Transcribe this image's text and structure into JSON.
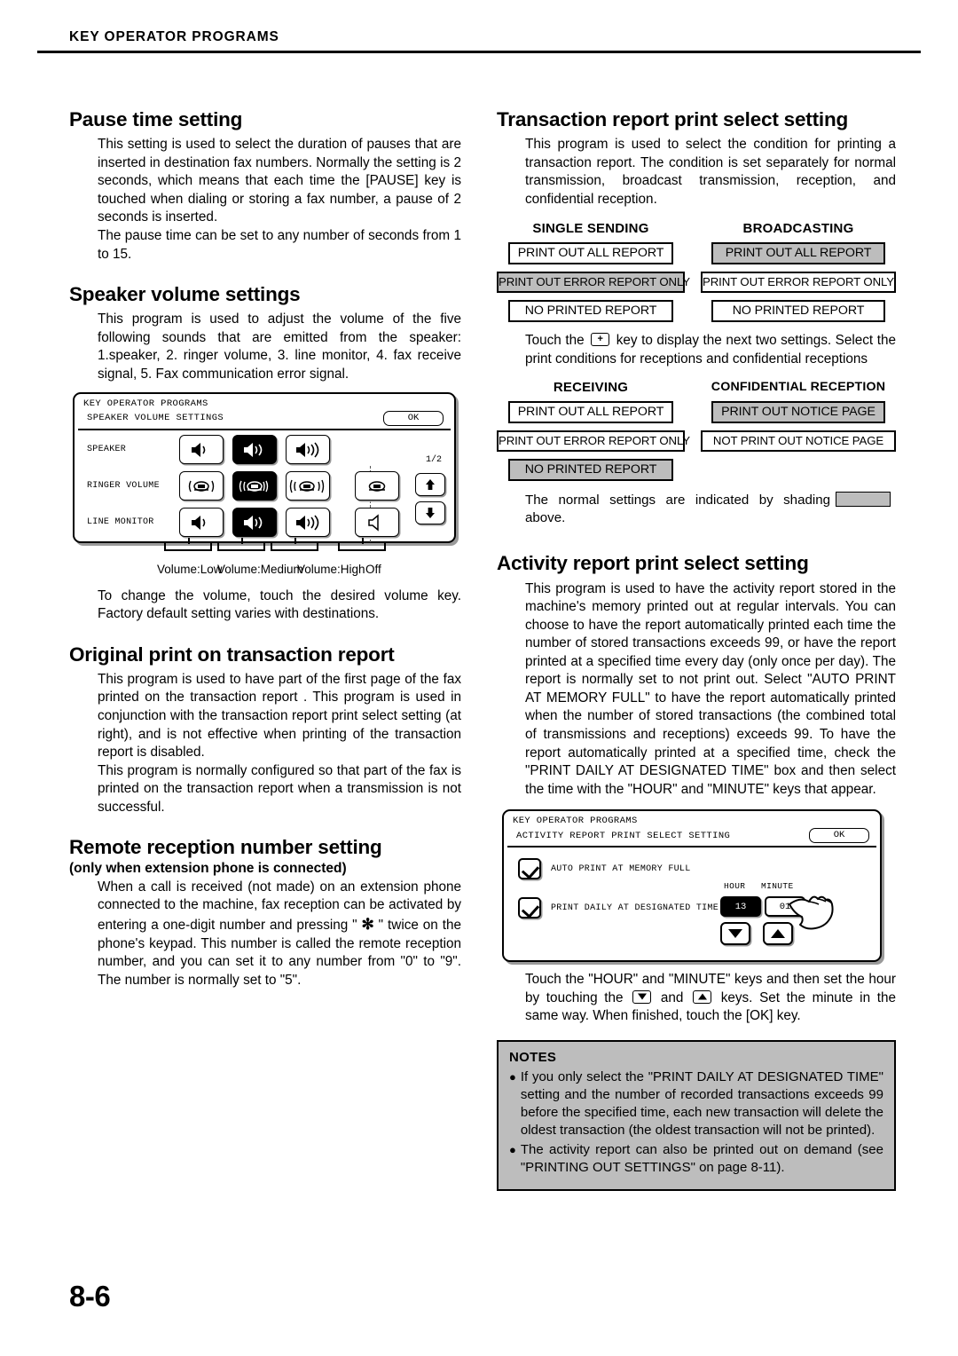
{
  "running_head": "KEY OPERATOR PROGRAMS",
  "folio": "8-6",
  "left_column": {
    "pause_time": {
      "heading": "Pause time setting",
      "p1": "This setting is used to select the duration of pauses that are inserted in destination fax numbers. Normally the setting is 2 seconds, which means that each time the [PAUSE] key is touched when dialing or storing a fax number, a pause of 2 seconds is inserted.",
      "p2": "The pause time can be set to any number of seconds from 1 to 15."
    },
    "speaker_volume": {
      "heading": "Speaker volume settings",
      "p1": "This program is used to adjust the volume of the five following sounds that are emitted from the speaker: 1.speaker, 2. ringer volume, 3. line monitor, 4. fax receive signal, 5. Fax communication error signal.",
      "panel": {
        "title": "KEY OPERATOR PROGRAMS",
        "subtitle": "SPEAKER VOLUME SETTINGS",
        "ok_label": "OK",
        "page_indicator": "1/2",
        "rows": [
          {
            "label": "SPEAKER",
            "keys": [
              "speaker-low",
              "speaker-medium",
              "speaker-high"
            ],
            "selected": 1,
            "has_off": false
          },
          {
            "label": "RINGER VOLUME",
            "keys": [
              "ringer-low",
              "ringer-medium",
              "ringer-high",
              "ringer-off"
            ],
            "selected": 1,
            "has_off": true
          },
          {
            "label": "LINE MONITOR",
            "keys": [
              "monitor-low",
              "monitor-medium",
              "monitor-high",
              "monitor-off"
            ],
            "selected": 1,
            "has_off": true
          }
        ],
        "column_labels": [
          "Volume:Low",
          "Volume:Medium",
          "Volume:High",
          "Off"
        ]
      },
      "p2": "To change the volume, touch the desired volume key. Factory default setting varies with destinations."
    },
    "original_print": {
      "heading": "Original print on transaction report",
      "p1": "This program is used to have part of the first page of the fax printed on the transaction report . This program is used in conjunction with the transaction report print select setting (at right), and is not effective when printing of the transaction report is disabled.",
      "p2": "This program is normally configured so that part of the fax is printed on the transaction report when a transmission is not successful."
    },
    "remote_reception": {
      "heading": "Remote reception number setting",
      "subheading": "(only when extension phone is connected)",
      "p1_a": "When a call is received (not made) on an extension phone connected to the machine, fax reception can be activated by entering a one-digit number and pressing \" ",
      "p1_star": "✻",
      "p1_b": " \" twice on the phone's keypad. This number is called the remote reception number, and you can set it to any number from \"0\" to \"9\". The number is normally set to \"5\"."
    }
  },
  "right_column": {
    "transaction_report": {
      "heading": "Transaction report print select setting",
      "p1": "This program is used to select the condition for printing a transaction report. The condition is set separately for normal transmission, broadcast transmission, reception, and confidential reception.",
      "group1": {
        "col_a_header": "SINGLE SENDING",
        "col_b_header": "BROADCASTING",
        "col_a_options": [
          {
            "label": "PRINT OUT ALL REPORT",
            "shaded": false
          },
          {
            "label": "PRINT OUT ERROR REPORT ONLY",
            "shaded": true
          },
          {
            "label": "NO PRINTED REPORT",
            "shaded": false
          }
        ],
        "col_b_options": [
          {
            "label": "PRINT OUT ALL REPORT",
            "shaded": true
          },
          {
            "label": "PRINT OUT ERROR REPORT ONLY",
            "shaded": false
          },
          {
            "label": "NO PRINTED REPORT",
            "shaded": false
          }
        ]
      },
      "mid_text_a": "Touch the ",
      "mid_key": "down-arrow-key",
      "mid_text_b": " key to display the next two settings. Select the print conditions for receptions and confidential receptions",
      "group2": {
        "col_a_header": "RECEIVING",
        "col_b_header": "CONFIDENTIAL RECEPTION",
        "col_a_options": [
          {
            "label": "PRINT OUT ALL REPORT",
            "shaded": false
          },
          {
            "label": "PRINT OUT ERROR REPORT ONLY",
            "shaded": false
          },
          {
            "label": "NO PRINTED REPORT",
            "shaded": true
          }
        ],
        "col_b_options": [
          {
            "label": "PRINT OUT NOTICE PAGE",
            "shaded": true
          },
          {
            "label": "NOT PRINT OUT NOTICE PAGE",
            "shaded": false
          }
        ]
      },
      "shading_note_a": "The normal settings are indicated by shading",
      "shading_note_b": "above."
    },
    "activity_report": {
      "heading": "Activity report print select setting",
      "p1": "This program is used to have the activity report stored in the machine's memory printed out at regular intervals. You can choose to have the report automatically printed each time the number of stored transactions exceeds 99, or have the report printed at a specified time every day (only once per day). The report is normally set to not print out. Select \"AUTO PRINT AT MEMORY FULL\" to have the report automatically printed when the number of stored transactions (the combined total of transmissions and receptions) exceeds 99. To have the report automatically printed at a specified time, check the \"PRINT DAILY AT DESIGNATED TIME\" box and then select the time with the \"HOUR\" and \"MINUTE\" keys that appear.",
      "panel": {
        "title": "KEY OPERATOR PROGRAMS",
        "subtitle": "ACTIVITY REPORT PRINT SELECT SETTING",
        "ok_label": "OK",
        "checkbox1_label": "AUTO PRINT AT MEMORY FULL",
        "checkbox1_checked": true,
        "checkbox2_label": "PRINT DAILY AT DESIGNATED TIME",
        "checkbox2_checked": true,
        "hour_label": "HOUR",
        "hour_value": "13",
        "hour_selected": true,
        "minute_label": "MINUTE",
        "minute_value": "01",
        "minute_selected": false
      },
      "p2_a": "Touch the \"HOUR\" and \"MINUTE\" keys and then set the hour by touching the ",
      "p2_b": " and ",
      "p2_c": " keys. Set the minute in the same way. When finished, touch the [OK] key."
    },
    "notes": {
      "title": "NOTES",
      "items": [
        "If you only select the \"PRINT DAILY AT DESIGNATED TIME\" setting and the number of recorded transactions exceeds 99 before the specified time, each new transaction will delete the oldest transaction (the oldest transaction will not be printed).",
        "The activity report can also be printed out on demand (see \"PRINTING OUT SETTINGS\" on page 8-11)."
      ]
    }
  },
  "colors": {
    "shade": "#bdbdbd",
    "ink": "#000000",
    "paper": "#ffffff"
  }
}
